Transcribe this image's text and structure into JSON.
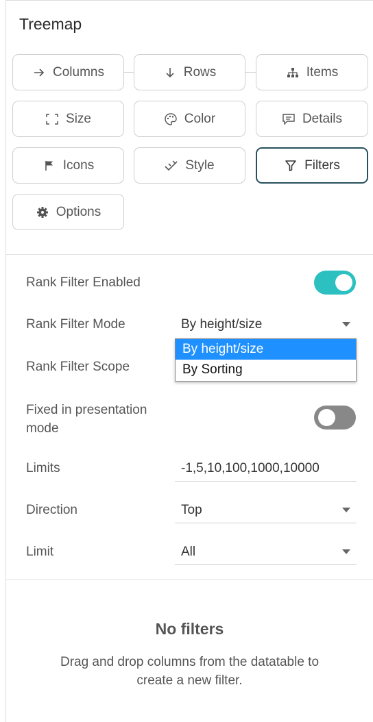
{
  "panel": {
    "title": "Treemap"
  },
  "buttons": {
    "columns": "Columns",
    "rows": "Rows",
    "items": "Items",
    "size": "Size",
    "color": "Color",
    "details": "Details",
    "icons": "Icons",
    "style": "Style",
    "filters": "Filters",
    "options": "Options"
  },
  "settings": {
    "rank_filter_enabled_label": "Rank Filter Enabled",
    "rank_filter_enabled": true,
    "rank_filter_mode_label": "Rank Filter Mode",
    "rank_filter_mode_value": "By height/size",
    "rank_filter_scope_label": "Rank Filter Scope",
    "fixed_presentation_label_line1": "Fixed in presentation",
    "fixed_presentation_label_line2": "mode",
    "fixed_presentation": false,
    "limits_label": "Limits",
    "limits_value": "-1,5,10,100,1000,10000",
    "direction_label": "Direction",
    "direction_value": "Top",
    "limit_label": "Limit",
    "limit_value": "All"
  },
  "dropdown": {
    "options": [
      "By height/size",
      "By Sorting"
    ],
    "selected_index": 0
  },
  "empty_state": {
    "title": "No filters",
    "text": "Drag and drop columns from the datatable to create a new filter."
  },
  "colors": {
    "toggle_on": "#2cc0c0",
    "toggle_off": "#888888",
    "active_border": "#27505e",
    "dropdown_selected": "#1e90ff"
  }
}
